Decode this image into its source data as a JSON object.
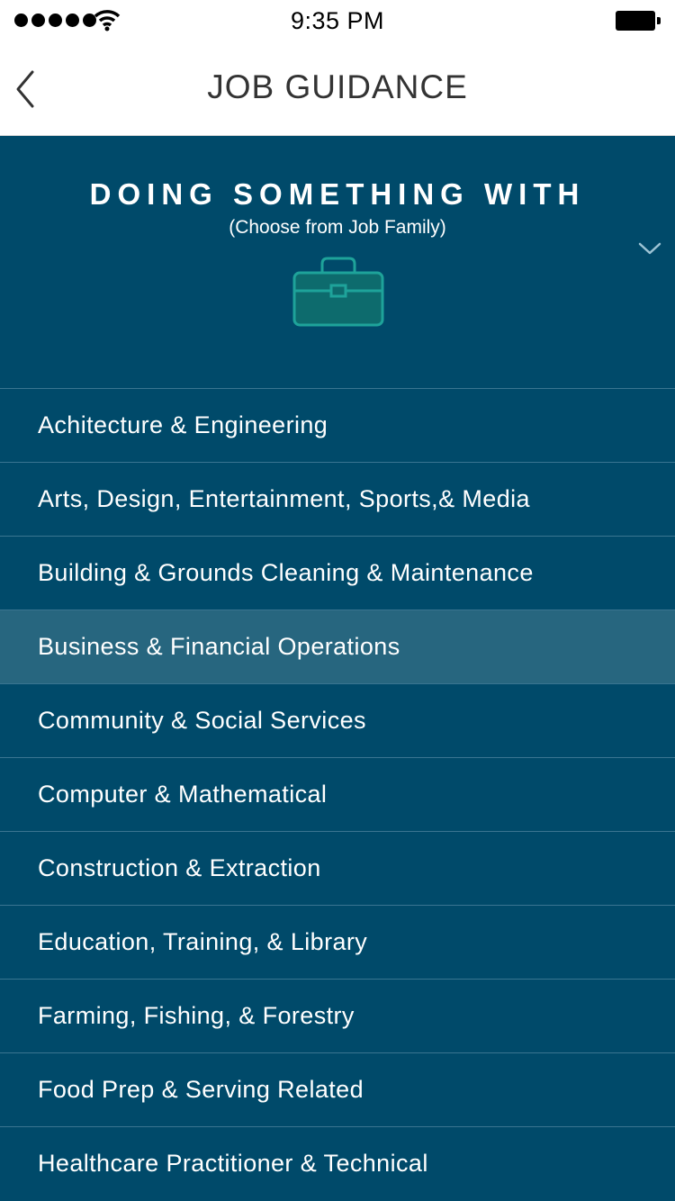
{
  "status_bar": {
    "time": "9:35 PM",
    "signal_icon": "signal-dots-icon",
    "wifi_icon": "wifi-icon",
    "battery_icon": "battery-icon"
  },
  "nav": {
    "title": "JOB GUIDANCE",
    "back_icon": "chevron-left-icon"
  },
  "header": {
    "title": "DOING SOMETHING WITH",
    "subtitle": "(Choose from Job Family)",
    "dropdown_icon": "chevron-down-icon",
    "illustration_icon": "briefcase-icon"
  },
  "colors": {
    "background": "#004a6a",
    "selected_row": "#27667f",
    "divider": "#3a7591",
    "briefcase_fill": "#0d6b6d",
    "briefcase_stroke": "#1ea39a"
  },
  "job_families": [
    {
      "label": "Achitecture & Engineering",
      "selected": false
    },
    {
      "label": "Arts, Design, Entertainment, Sports,& Media",
      "selected": false
    },
    {
      "label": "Building & Grounds Cleaning & Maintenance",
      "selected": false
    },
    {
      "label": "Business & Financial Operations",
      "selected": true
    },
    {
      "label": "Community & Social Services",
      "selected": false
    },
    {
      "label": "Computer & Mathematical",
      "selected": false
    },
    {
      "label": "Construction & Extraction",
      "selected": false
    },
    {
      "label": "Education, Training, & Library",
      "selected": false
    },
    {
      "label": "Farming, Fishing, & Forestry",
      "selected": false
    },
    {
      "label": "Food Prep & Serving Related",
      "selected": false
    },
    {
      "label": "Healthcare Practitioner & Technical",
      "selected": false
    }
  ]
}
